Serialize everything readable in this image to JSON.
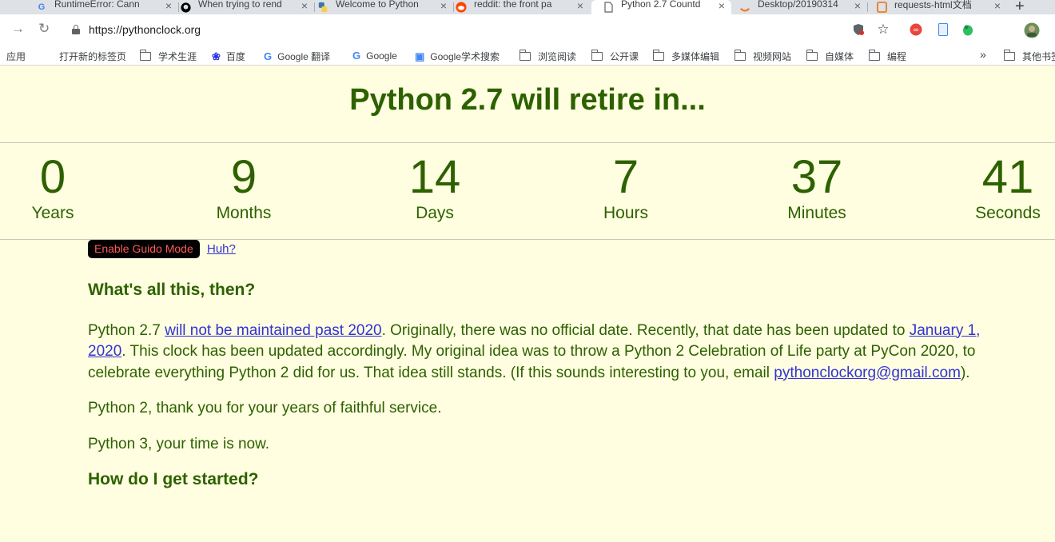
{
  "browser": {
    "tabs": [
      {
        "title": "RuntimeError: Cann",
        "icon": "G",
        "icon_color": "#4285f4",
        "active": false
      },
      {
        "title": "When trying to rend",
        "icon": "github-icon",
        "icon_color": "#000000",
        "active": false
      },
      {
        "title": "Welcome to Python",
        "icon": "python-icon",
        "icon_color": "#3b77a8",
        "active": false
      },
      {
        "title": "reddit: the front pa",
        "icon": "reddit-icon",
        "icon_color": "#ff4500",
        "active": false
      },
      {
        "title": "Python 2.7 Countd",
        "icon": "page-icon",
        "icon_color": "#5f6368",
        "active": true
      },
      {
        "title": "Desktop/20190314",
        "icon": "jupyter-icon",
        "icon_color": "#f37626",
        "active": false
      },
      {
        "title": "requests-html文档",
        "icon": "book-icon",
        "icon_color": "#e8710a",
        "active": false
      }
    ],
    "url": "https://pythonclock.org",
    "bookmarks": [
      {
        "label": "应用",
        "icon": "apps"
      },
      {
        "label": "打开新的标签页",
        "icon": "none"
      },
      {
        "label": "学术生涯",
        "icon": "folder"
      },
      {
        "label": "百度",
        "icon": "baidu"
      },
      {
        "label": "Google 翻译",
        "icon": "translate"
      },
      {
        "label": "Google",
        "icon": "google"
      },
      {
        "label": "Google学术搜索",
        "icon": "scholar"
      },
      {
        "label": "浏览阅读",
        "icon": "folder"
      },
      {
        "label": "公开课",
        "icon": "folder"
      },
      {
        "label": "多媒体编辑",
        "icon": "folder"
      },
      {
        "label": "视频网站",
        "icon": "folder"
      },
      {
        "label": "自媒体",
        "icon": "folder"
      },
      {
        "label": "编程",
        "icon": "folder"
      },
      {
        "label": "»",
        "icon": "none"
      },
      {
        "label": "其他书签",
        "icon": "folder"
      }
    ]
  },
  "page": {
    "heading": "Python 2.7 will retire in...",
    "countdown": [
      {
        "value": "0",
        "label": "Years"
      },
      {
        "value": "9",
        "label": "Months"
      },
      {
        "value": "14",
        "label": "Days"
      },
      {
        "value": "7",
        "label": "Hours"
      },
      {
        "value": "37",
        "label": "Minutes"
      },
      {
        "value": "41",
        "label": "Seconds"
      }
    ],
    "guido_button": "Enable Guido Mode",
    "huh_link": "Huh?",
    "section1_title": "What's all this, then?",
    "p1": {
      "t1": "Python 2.7 ",
      "link1": "will not be maintained past 2020",
      "t2": ". Originally, there was no official date. Recently, that date has been updated to ",
      "link2": "January 1, 2020",
      "t3": ". This clock has been updated accordingly. My original idea was to throw a Python 2 Celebration of Life party at PyCon 2020, to celebrate everything Python 2 did for us. That idea still stands. (If this sounds interesting to you, email ",
      "link3": "pythonclockorg@gmail.com",
      "t4": ")."
    },
    "p2": "Python 2, thank you for your years of faithful service.",
    "p3": "Python 3, your time is now.",
    "section2_title": "How do I get started?"
  },
  "colors": {
    "page_bg": "#fffee0",
    "text_green": "#2d6100",
    "link_blue": "#3133d3",
    "button_bg": "#000000",
    "button_text": "#ff5a5a"
  }
}
